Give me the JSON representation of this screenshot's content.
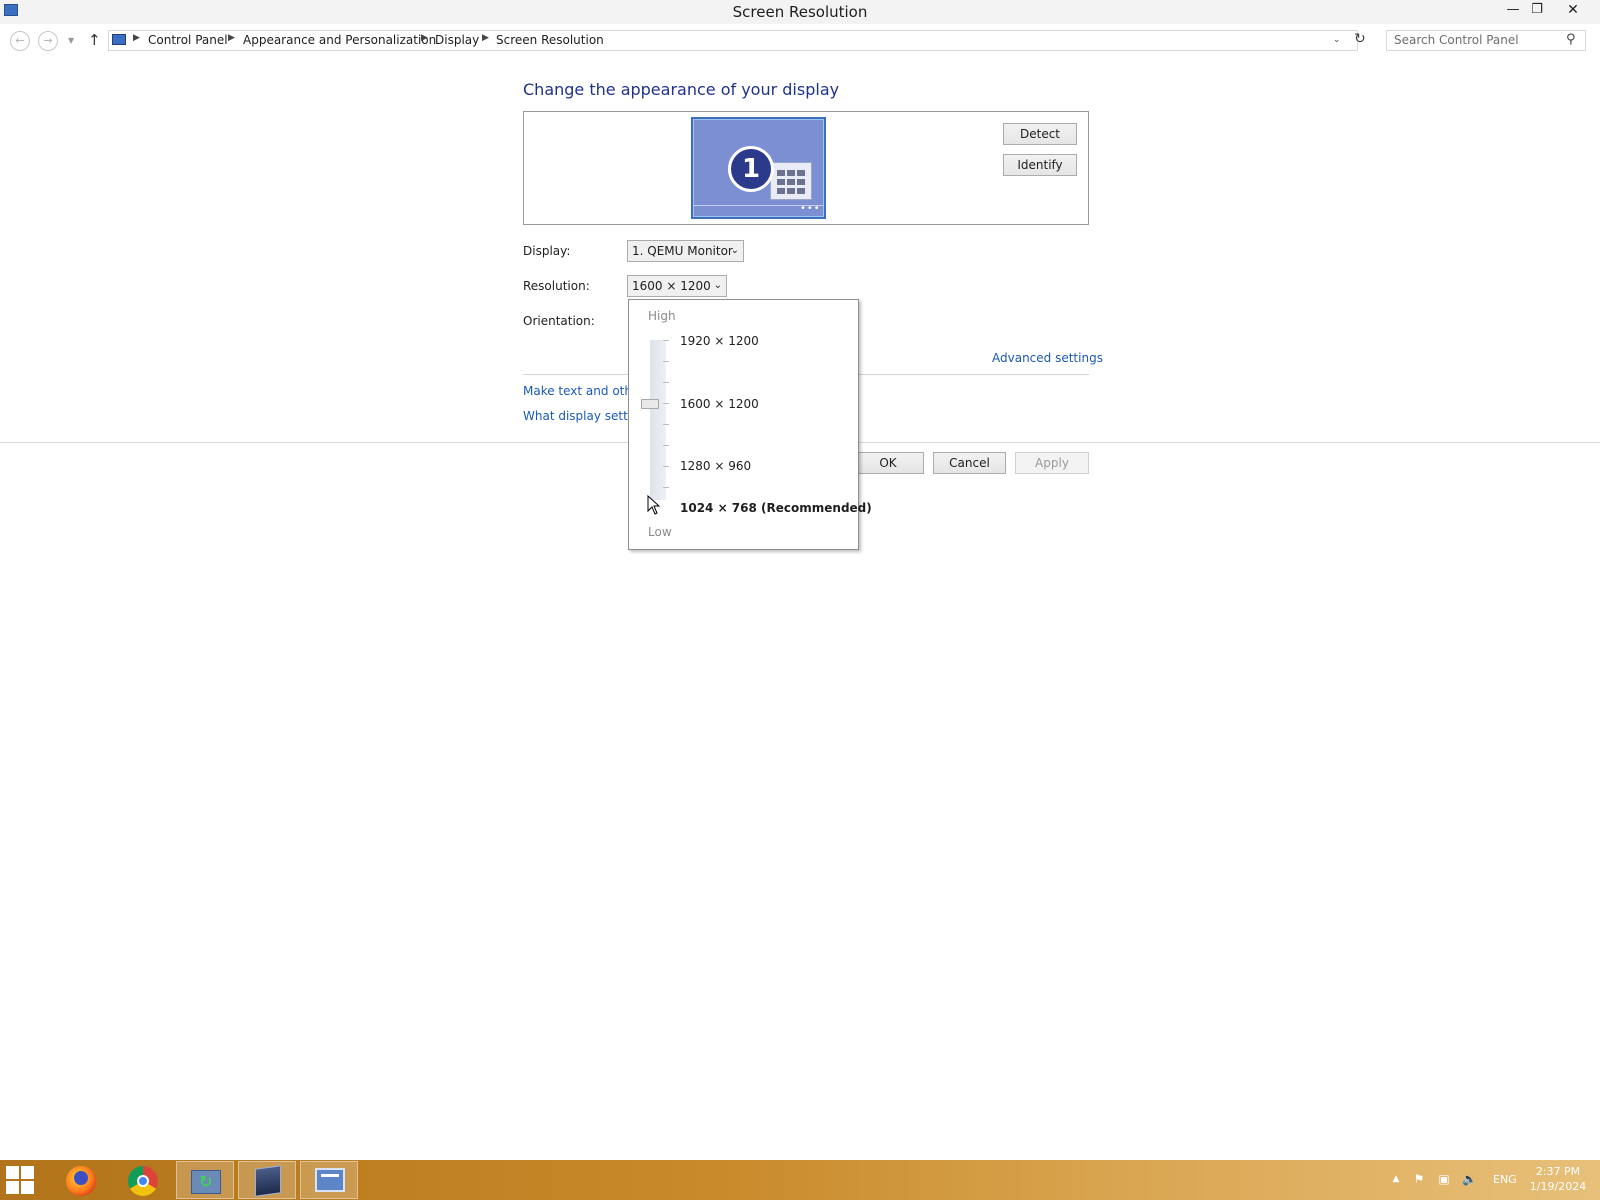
{
  "window": {
    "title": "Screen Resolution",
    "minimize_glyph": "—",
    "restore_glyph": "❐",
    "close_glyph": "✕"
  },
  "address_bar": {
    "breadcrumbs": [
      "Control Panel",
      "Appearance and Personalization",
      "Display",
      "Screen Resolution"
    ],
    "search_placeholder": "Search Control Panel"
  },
  "main": {
    "heading": "Change the appearance of your display",
    "monitor_number": "1",
    "detect_button": "Detect",
    "identify_button": "Identify",
    "display_label": "Display:",
    "display_value": "1. QEMU Monitor",
    "resolution_label": "Resolution:",
    "resolution_value": "1600 × 1200",
    "orientation_label": "Orientation:",
    "advanced_settings_link": "Advanced settings",
    "link_text_size": "Make text and other",
    "link_display_settings": "What display setting",
    "ok_button": "OK",
    "cancel_button": "Cancel",
    "apply_button": "Apply"
  },
  "resolution_dropdown": {
    "high_label": "High",
    "low_label": "Low",
    "options": [
      "1920 × 1200",
      "1600 × 1200",
      "1280 × 960",
      "1024 × 768 (Recommended)"
    ],
    "selected": "1600 × 1200"
  },
  "taskbar": {
    "apps": [
      "windows-start",
      "firefox",
      "chrome",
      "sync-app",
      "virtualbox",
      "control-panel"
    ],
    "active_app": "control-panel",
    "language": "ENG",
    "time": "2:37 PM",
    "date": "1/19/2024"
  },
  "colors": {
    "heading_blue": "#1e3287",
    "link_blue": "#1a5ab4",
    "taskbar_orange": "#c98a2a",
    "monitor_blue": "#7b8fd2"
  }
}
